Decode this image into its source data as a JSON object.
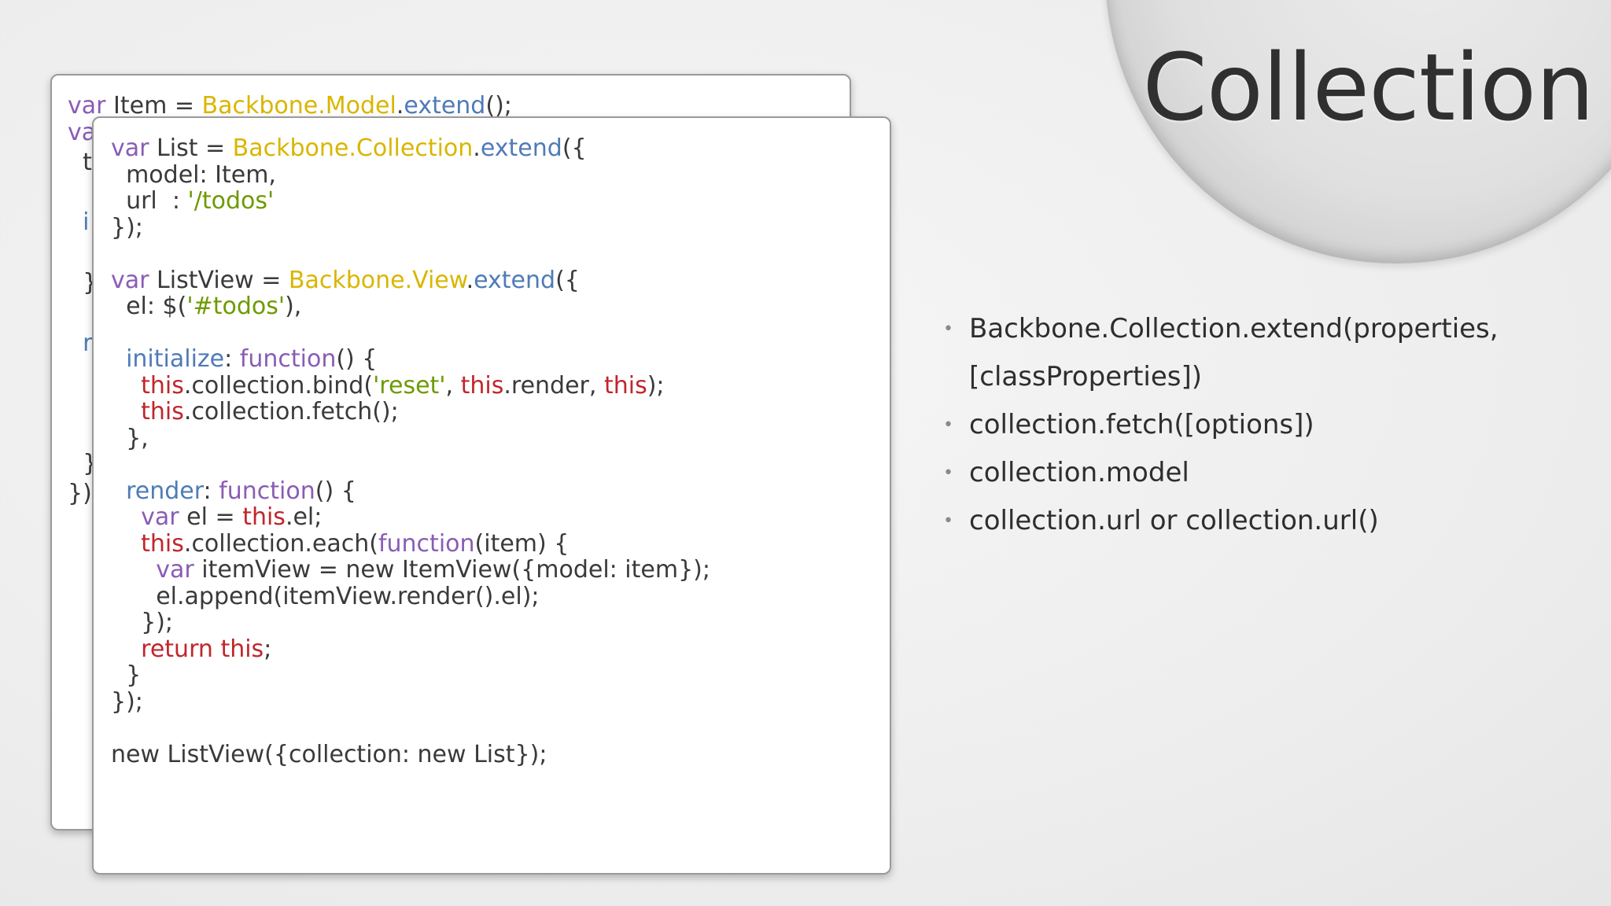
{
  "slide": {
    "title": "Collection"
  },
  "code_back": {
    "line1": [
      {
        "t": "var",
        "c": "kw"
      },
      {
        "t": " Item = ",
        "c": ""
      },
      {
        "t": "Backbone.Model",
        "c": "bb"
      },
      {
        "t": ".",
        "c": ""
      },
      {
        "t": "extend",
        "c": "mt"
      },
      {
        "t": "();",
        "c": ""
      }
    ],
    "visible_fragments": [
      "va",
      "t",
      "i",
      "}",
      "r",
      "}",
      "});"
    ]
  },
  "code_front": {
    "lines": [
      [
        {
          "t": "var",
          "c": "kw"
        },
        {
          "t": " List = ",
          "c": ""
        },
        {
          "t": "Backbone.Collection",
          "c": "bb"
        },
        {
          "t": ".",
          "c": ""
        },
        {
          "t": "extend",
          "c": "mt"
        },
        {
          "t": "({",
          "c": ""
        }
      ],
      [
        {
          "t": "  model: Item,",
          "c": ""
        }
      ],
      [
        {
          "t": "  url  : ",
          "c": ""
        },
        {
          "t": "'/todos'",
          "c": "str"
        }
      ],
      [
        {
          "t": "});",
          "c": ""
        }
      ],
      [
        {
          "t": "",
          "c": ""
        }
      ],
      [
        {
          "t": "var",
          "c": "kw"
        },
        {
          "t": " ListView = ",
          "c": ""
        },
        {
          "t": "Backbone.View",
          "c": "bb"
        },
        {
          "t": ".",
          "c": ""
        },
        {
          "t": "extend",
          "c": "mt"
        },
        {
          "t": "({",
          "c": ""
        }
      ],
      [
        {
          "t": "  el: $(",
          "c": ""
        },
        {
          "t": "'#todos'",
          "c": "str"
        },
        {
          "t": "),",
          "c": ""
        }
      ],
      [
        {
          "t": "",
          "c": ""
        }
      ],
      [
        {
          "t": "  ",
          "c": ""
        },
        {
          "t": "initialize",
          "c": "prop"
        },
        {
          "t": ": ",
          "c": ""
        },
        {
          "t": "function",
          "c": "fn"
        },
        {
          "t": "() {",
          "c": ""
        }
      ],
      [
        {
          "t": "    ",
          "c": ""
        },
        {
          "t": "this",
          "c": "th"
        },
        {
          "t": ".collection.bind(",
          "c": ""
        },
        {
          "t": "'reset'",
          "c": "str"
        },
        {
          "t": ", ",
          "c": ""
        },
        {
          "t": "this",
          "c": "th"
        },
        {
          "t": ".render, ",
          "c": ""
        },
        {
          "t": "this",
          "c": "th"
        },
        {
          "t": ");",
          "c": ""
        }
      ],
      [
        {
          "t": "    ",
          "c": ""
        },
        {
          "t": "this",
          "c": "th"
        },
        {
          "t": ".collection.fetch();",
          "c": ""
        }
      ],
      [
        {
          "t": "  },",
          "c": ""
        }
      ],
      [
        {
          "t": "",
          "c": ""
        }
      ],
      [
        {
          "t": "  ",
          "c": ""
        },
        {
          "t": "render",
          "c": "prop"
        },
        {
          "t": ": ",
          "c": ""
        },
        {
          "t": "function",
          "c": "fn"
        },
        {
          "t": "() {",
          "c": ""
        }
      ],
      [
        {
          "t": "    ",
          "c": ""
        },
        {
          "t": "var",
          "c": "kw"
        },
        {
          "t": " el = ",
          "c": ""
        },
        {
          "t": "this",
          "c": "th"
        },
        {
          "t": ".el;",
          "c": ""
        }
      ],
      [
        {
          "t": "    ",
          "c": ""
        },
        {
          "t": "this",
          "c": "th"
        },
        {
          "t": ".collection.each(",
          "c": ""
        },
        {
          "t": "function",
          "c": "fn"
        },
        {
          "t": "(item) {",
          "c": ""
        }
      ],
      [
        {
          "t": "      ",
          "c": ""
        },
        {
          "t": "var",
          "c": "kw"
        },
        {
          "t": " itemView = new ItemView({model: item});",
          "c": ""
        }
      ],
      [
        {
          "t": "      el.append(itemView.render().el);",
          "c": ""
        }
      ],
      [
        {
          "t": "    });",
          "c": ""
        }
      ],
      [
        {
          "t": "    ",
          "c": ""
        },
        {
          "t": "return",
          "c": "th"
        },
        {
          "t": " ",
          "c": ""
        },
        {
          "t": "this",
          "c": "th"
        },
        {
          "t": ";",
          "c": ""
        }
      ],
      [
        {
          "t": "  }",
          "c": ""
        }
      ],
      [
        {
          "t": "});",
          "c": ""
        }
      ],
      [
        {
          "t": "",
          "c": ""
        }
      ],
      [
        {
          "t": "new ListView({collection: new List});",
          "c": ""
        }
      ]
    ]
  },
  "bullets": [
    "Backbone.Collection.extend(properties,",
    "[classProperties])",
    "collection.fetch([options])",
    "collection.model",
    "collection.url or collection.url()"
  ],
  "bullet_markers": [
    true,
    false,
    true,
    true,
    true
  ],
  "bullet_glyph": "•"
}
